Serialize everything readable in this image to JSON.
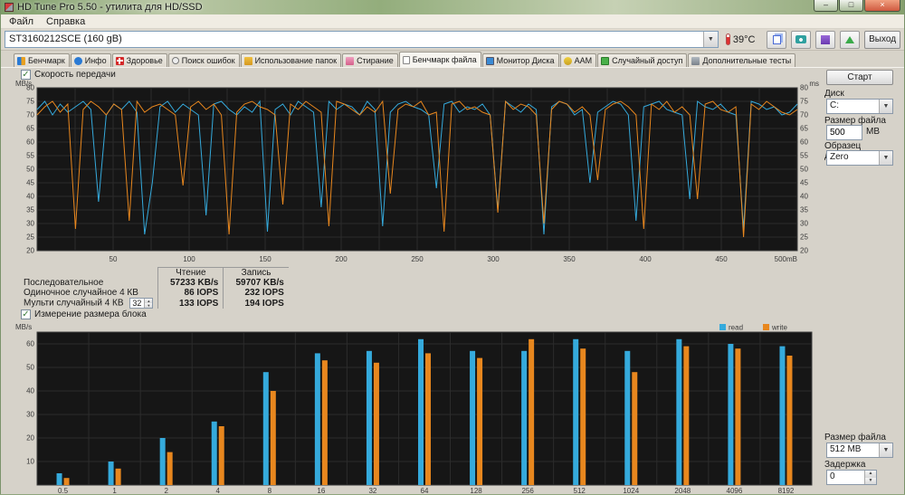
{
  "window": {
    "title": "HD Tune Pro 5.50 - утилита для HD/SSD"
  },
  "menu": {
    "items": [
      "Файл",
      "Справка"
    ]
  },
  "toolbar": {
    "drive_select": "ST3160212SCE (160 gB)",
    "temperature": "39°C",
    "exit_button": "Выход"
  },
  "tabs": {
    "items": [
      "Бенчмарк",
      "Инфо",
      "Здоровье",
      "Поиск ошибок",
      "Использование папок",
      "Стирание",
      "Бенчмарк файла",
      "Монитор Диска",
      "AAM",
      "Случайный доступ",
      "Дополнительные тесты"
    ],
    "active": "Бенчмарк файла"
  },
  "panel": {
    "speed_checkbox": "Скорость передачи",
    "block_checkbox": "Измерение размера блока",
    "start_button": "Старт",
    "disk_label": "Диск",
    "disk_value": "C:",
    "file_size_label": "Размер файла",
    "file_size_value": "500",
    "file_size_unit": "MB",
    "pattern_label": "Образец данных",
    "pattern_value": "Zero",
    "file_size2_label": "Размер файла",
    "file_size2_value": "512 MB",
    "delay_label": "Задержка",
    "delay_value": "0"
  },
  "results": {
    "headers": {
      "read": "Чтение",
      "write": "Запись"
    },
    "rows": [
      {
        "label": "Последовательное",
        "read": "57233 KB/s",
        "write": "59707 KB/s"
      },
      {
        "label": "Одиночное случайное 4 КВ",
        "read": "86 IOPS",
        "write": "232 IOPS"
      },
      {
        "label": "Мульти случайный 4 КВ",
        "spinner": "32",
        "read": "133 IOPS",
        "write": "194 IOPS"
      }
    ]
  },
  "chart_data": [
    {
      "type": "line",
      "title": "Скорость передачи",
      "ylabel_left": "MB/s",
      "ylabel_right": "ms",
      "ylim": [
        20,
        80
      ],
      "ytick_step": 5,
      "xlim": [
        0,
        500
      ],
      "xgrid_step": 25,
      "xticks": [
        50,
        100,
        150,
        200,
        250,
        300,
        350,
        400,
        450,
        500
      ],
      "xtick_labels": [
        "50",
        "100",
        "150",
        "200",
        "250",
        "300",
        "350",
        "400",
        "450",
        "500mB"
      ],
      "grid": true,
      "series": [
        {
          "name": "read",
          "color": "#35aadc",
          "values": [
            72,
            75,
            70,
            74,
            71,
            73,
            75,
            72,
            38,
            70,
            74,
            72,
            75,
            71,
            26,
            45,
            73,
            75,
            71,
            74,
            72,
            70,
            33,
            74,
            75,
            72,
            70,
            73,
            71,
            75,
            27,
            72,
            74,
            70,
            75,
            73,
            71,
            36,
            75,
            72,
            74,
            73,
            70,
            75,
            72,
            29,
            71,
            74,
            75,
            73,
            72,
            70,
            43,
            74,
            75,
            71,
            73,
            72,
            74,
            70,
            35,
            75,
            73,
            71,
            74,
            72,
            26,
            73,
            75,
            74,
            70,
            72,
            45,
            71,
            73,
            75,
            74,
            70,
            31,
            73,
            74,
            75,
            72,
            71,
            70,
            39,
            75,
            73,
            72,
            74,
            71,
            70,
            28,
            75,
            74,
            72,
            73,
            70,
            71,
            74
          ]
        },
        {
          "name": "write",
          "color": "#e8871e",
          "values": [
            70,
            73,
            75,
            71,
            74,
            28,
            72,
            75,
            73,
            70,
            74,
            72,
            31,
            75,
            71,
            73,
            74,
            72,
            70,
            44,
            73,
            75,
            72,
            74,
            70,
            26,
            71,
            74,
            75,
            73,
            72,
            70,
            37,
            74,
            72,
            75,
            73,
            71,
            29,
            75,
            74,
            72,
            70,
            73,
            71,
            75,
            41,
            72,
            74,
            73,
            75,
            70,
            71,
            27,
            74,
            75,
            72,
            73,
            71,
            70,
            34,
            75,
            72,
            74,
            73,
            70,
            30,
            72,
            75,
            74,
            71,
            73,
            70,
            46,
            72,
            74,
            75,
            73,
            70,
            28,
            74,
            72,
            75,
            71,
            73,
            70,
            39,
            74,
            75,
            72,
            71,
            73,
            25,
            74,
            72,
            75,
            73,
            71,
            70,
            72
          ]
        }
      ]
    },
    {
      "type": "bar",
      "title": "Измерение размера блока",
      "ylabel": "MB/s",
      "ylim": [
        0,
        65
      ],
      "ytick_step": 10,
      "categories": [
        "0.5",
        "1",
        "2",
        "4",
        "8",
        "16",
        "32",
        "64",
        "128",
        "256",
        "512",
        "1024",
        "2048",
        "4096",
        "8192"
      ],
      "legend_position": "top-right",
      "grid": true,
      "series": [
        {
          "name": "read",
          "color": "#35aadc",
          "values": [
            5,
            10,
            20,
            27,
            48,
            56,
            57,
            62,
            57,
            57,
            62,
            57,
            62,
            60,
            59
          ]
        },
        {
          "name": "write",
          "color": "#e8871e",
          "values": [
            3,
            7,
            14,
            25,
            40,
            53,
            52,
            56,
            54,
            62,
            58,
            48,
            59,
            58,
            55
          ]
        }
      ]
    }
  ]
}
